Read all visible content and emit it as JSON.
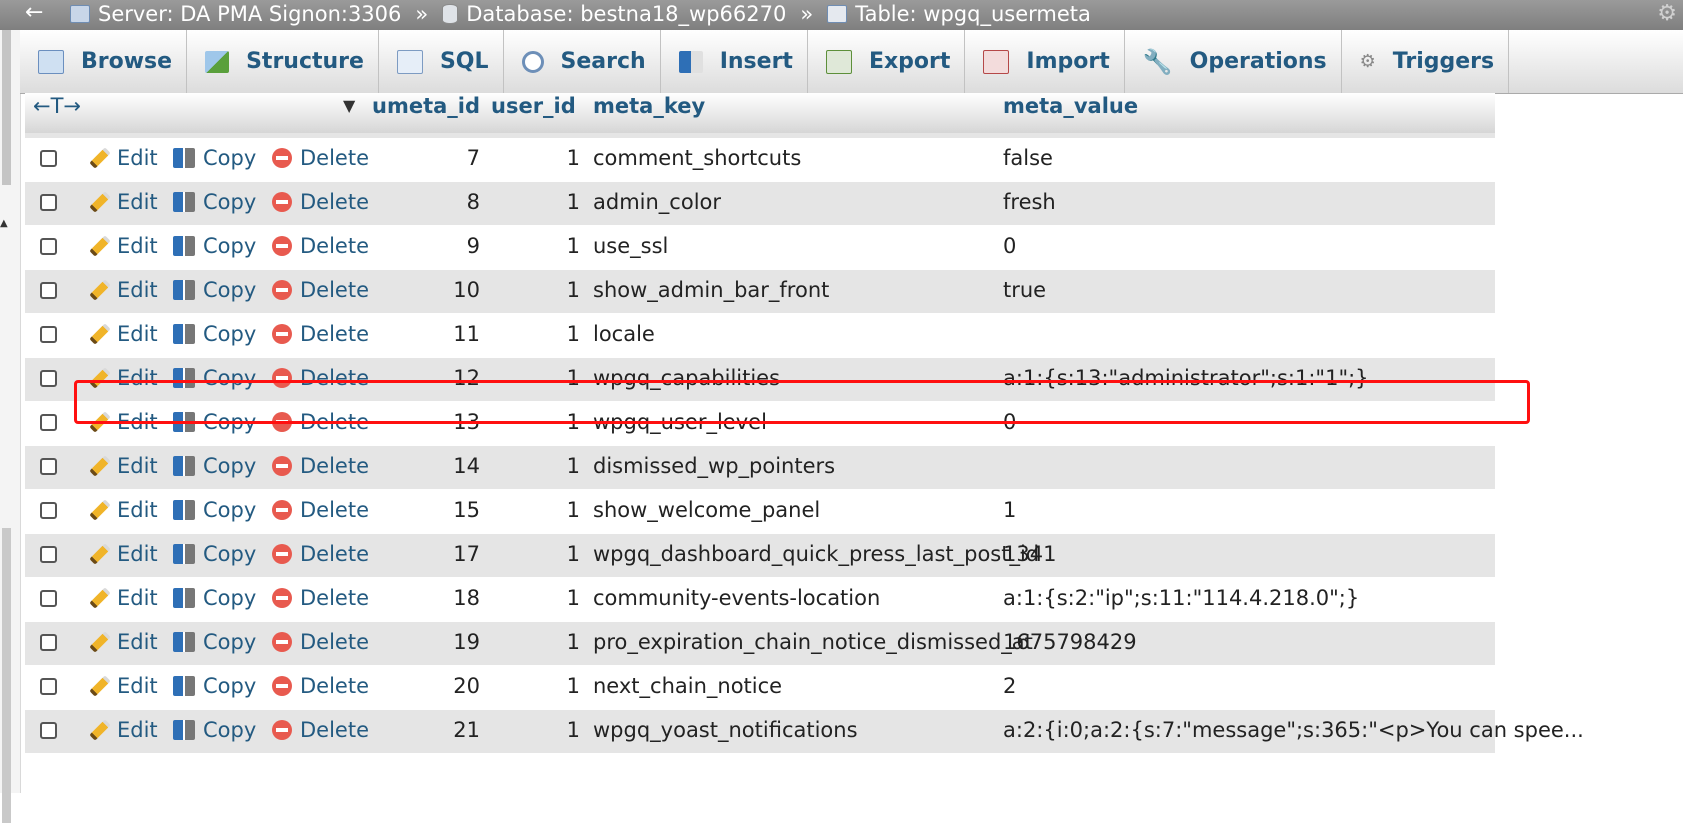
{
  "breadcrumb": {
    "back": "←",
    "server": "Server: DA PMA Signon:3306",
    "database": "Database: bestna18_wp66270",
    "table": "Table: wpgq_usermeta",
    "separator": "»",
    "settings_icon": "gear-icon"
  },
  "tabs": [
    {
      "label": "Browse",
      "icon": "browse-icon"
    },
    {
      "label": "Structure",
      "icon": "structure-icon"
    },
    {
      "label": "SQL",
      "icon": "sql-icon"
    },
    {
      "label": "Search",
      "icon": "search-icon"
    },
    {
      "label": "Insert",
      "icon": "insert-icon"
    },
    {
      "label": "Export",
      "icon": "export-icon"
    },
    {
      "label": "Import",
      "icon": "import-icon"
    },
    {
      "label": "Operations",
      "icon": "wrench-icon"
    },
    {
      "label": "Triggers",
      "icon": "triggers-icon"
    }
  ],
  "table": {
    "arrows": "←T→",
    "sort_indicator": "▼",
    "columns": [
      "umeta_id",
      "user_id",
      "meta_key",
      "meta_value"
    ],
    "actions": {
      "edit": "Edit",
      "copy": "Copy",
      "delete": "Delete"
    },
    "rows": [
      {
        "umeta_id": "7",
        "user_id": "1",
        "meta_key": "comment_shortcuts",
        "meta_value": "false"
      },
      {
        "umeta_id": "8",
        "user_id": "1",
        "meta_key": "admin_color",
        "meta_value": "fresh"
      },
      {
        "umeta_id": "9",
        "user_id": "1",
        "meta_key": "use_ssl",
        "meta_value": "0"
      },
      {
        "umeta_id": "10",
        "user_id": "1",
        "meta_key": "show_admin_bar_front",
        "meta_value": "true"
      },
      {
        "umeta_id": "11",
        "user_id": "1",
        "meta_key": "locale",
        "meta_value": ""
      },
      {
        "umeta_id": "12",
        "user_id": "1",
        "meta_key": "wpgq_capabilities",
        "meta_value": "a:1:{s:13:\"administrator\";s:1:\"1\";}"
      },
      {
        "umeta_id": "13",
        "user_id": "1",
        "meta_key": "wpgq_user_level",
        "meta_value": "0"
      },
      {
        "umeta_id": "14",
        "user_id": "1",
        "meta_key": "dismissed_wp_pointers",
        "meta_value": ""
      },
      {
        "umeta_id": "15",
        "user_id": "1",
        "meta_key": "show_welcome_panel",
        "meta_value": "1"
      },
      {
        "umeta_id": "17",
        "user_id": "1",
        "meta_key": "wpgq_dashboard_quick_press_last_post_id",
        "meta_value": "1341"
      },
      {
        "umeta_id": "18",
        "user_id": "1",
        "meta_key": "community-events-location",
        "meta_value": "a:1:{s:2:\"ip\";s:11:\"114.4.218.0\";}"
      },
      {
        "umeta_id": "19",
        "user_id": "1",
        "meta_key": "pro_expiration_chain_notice_dismissed_at",
        "meta_value": "1675798429"
      },
      {
        "umeta_id": "20",
        "user_id": "1",
        "meta_key": "next_chain_notice",
        "meta_value": "2"
      },
      {
        "umeta_id": "21",
        "user_id": "1",
        "meta_key": "wpgq_yoast_notifications",
        "meta_value": "a:2:{i:0;a:2:{s:7:\"message\";s:365:\"<p>You can spee..."
      }
    ]
  },
  "colors": {
    "link": "#235a81",
    "highlight": "#ff1010",
    "row_alt": "#e5e5e5"
  }
}
